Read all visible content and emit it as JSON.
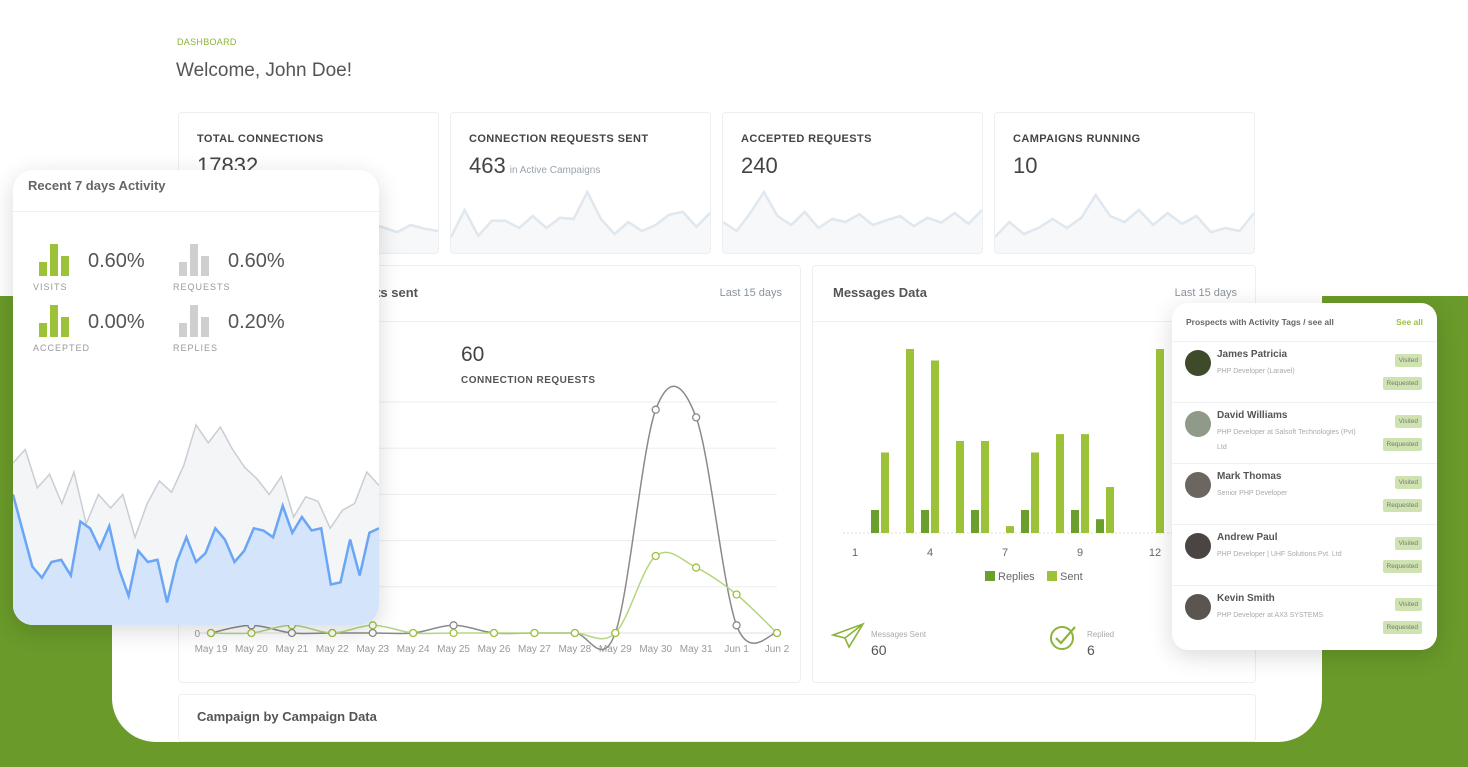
{
  "colors": {
    "brand_green": "#6a9a2a",
    "light_green": "#9cc23a",
    "dark_green": "#6a9f2e",
    "gray_line": "#8a8a8a",
    "blue": "#6aa6f5",
    "sparkline": "#dfe7ef"
  },
  "header": {
    "breadcrumb": "DASHBOARD",
    "welcome": "Welcome, John Doe!"
  },
  "kpis": [
    {
      "label": "TOTAL CONNECTIONS",
      "value": "17832",
      "sub": "",
      "spark": [
        30,
        40,
        35,
        45,
        38,
        42,
        30,
        35,
        25,
        40,
        33,
        45,
        38,
        30,
        42,
        36,
        28,
        40,
        34,
        30
      ]
    },
    {
      "label": "CONNECTION REQUESTS SENT",
      "value": "463",
      "sub": "in Active Campaigns",
      "spark": [
        20,
        65,
        22,
        47,
        47,
        35,
        55,
        35,
        52,
        50,
        95,
        50,
        25,
        45,
        30,
        40,
        57,
        62,
        37,
        60
      ]
    },
    {
      "label": "ACCEPTED REQUESTS",
      "value": "240",
      "sub": "",
      "spark": [
        45,
        30,
        60,
        95,
        55,
        40,
        62,
        35,
        50,
        45,
        58,
        40,
        48,
        55,
        38,
        52,
        44,
        60,
        42,
        65
      ]
    },
    {
      "label": "CAMPAIGNS RUNNING",
      "value": "10",
      "sub": "",
      "spark": [
        20,
        45,
        25,
        35,
        50,
        35,
        52,
        90,
        55,
        45,
        65,
        40,
        60,
        42,
        55,
        28,
        35,
        30,
        60
      ]
    }
  ],
  "connections_chart": {
    "title": "Requests sent",
    "period": "Last 15 days",
    "total": "60",
    "total_label": "CONNECTION REQUESTS"
  },
  "messages_chart": {
    "title": "Messages Data",
    "period": "Last 15 days",
    "sent_label": "Messages Sent",
    "sent_value": "60",
    "replied_label": "Replied",
    "replied_value": "6"
  },
  "prospects": {
    "title": "Prospects with Activity Tags / see all",
    "see_all": "See all",
    "tag_visited": "Visited",
    "tag_requested": "Requested",
    "items": [
      {
        "name": "James Patricia",
        "desc": "PHP Developer (Laravel)"
      },
      {
        "name": "David Williams",
        "desc": "PHP Developer at Salsoft Technologies (Pvt) Ltd"
      },
      {
        "name": "Mark Thomas",
        "desc": "Senior PHP Developer"
      },
      {
        "name": "Andrew Paul",
        "desc": "PHP Developer | UHF Solutions Pvt. Ltd"
      },
      {
        "name": "Kevin Smith",
        "desc": "PHP Developer at AX3 SYSTEMS"
      }
    ]
  },
  "activity": {
    "title": "Recent 7 days Activity",
    "stats": [
      {
        "label": "VISITS",
        "value": "0.60%",
        "color": "#9cc23a"
      },
      {
        "label": "REQUESTS",
        "value": "0.60%",
        "color": "#cfcfcf"
      },
      {
        "label": "ACCEPTED",
        "value": "0.00%",
        "color": "#9cc23a"
      },
      {
        "label": "REPLIES",
        "value": "0.20%",
        "color": "#cfcfcf"
      }
    ]
  },
  "campaign_section": {
    "title": "Campaign by Campaign Data"
  },
  "chart_data": [
    {
      "type": "line",
      "title": "Requests sent",
      "x": [
        "May 19",
        "May 20",
        "May 21",
        "May 22",
        "May 23",
        "May 24",
        "May 25",
        "May 26",
        "May 27",
        "May 28",
        "May 29",
        "May 30",
        "May 31",
        "Jun 1",
        "Jun 2"
      ],
      "series": [
        {
          "color": "#8a8a8a",
          "values": [
            0,
            1,
            0,
            0,
            0,
            0,
            1,
            0,
            0,
            0,
            0,
            29,
            28,
            1,
            0
          ]
        },
        {
          "color": "#9cc23a",
          "values": [
            0,
            0,
            1,
            0,
            1,
            0,
            0,
            0,
            0,
            0,
            0,
            10,
            8.5,
            5,
            0
          ]
        }
      ],
      "ylim": [
        0,
        30
      ],
      "y_tick_labels": [
        "0"
      ],
      "grid": true
    },
    {
      "type": "bar",
      "title": "Messages Data",
      "x_tick_labels": [
        "1",
        "4",
        "7",
        "9",
        "12"
      ],
      "series": [
        {
          "name": "Replies",
          "color": "#6a9f2e",
          "values": [
            0,
            1,
            0,
            1,
            0,
            1,
            0,
            1,
            0,
            1,
            0.6,
            0,
            0
          ]
        },
        {
          "name": "Sent",
          "color": "#9cc23a",
          "values": [
            0,
            3.5,
            8,
            7.5,
            4,
            4,
            0.3,
            3.5,
            4.3,
            4.3,
            2,
            0,
            8
          ]
        }
      ],
      "legend": "bottom"
    },
    {
      "type": "area",
      "title": "Recent 7 days Activity",
      "series": [
        {
          "color": "#c9ced4",
          "values": [
            72,
            78,
            61,
            67,
            54,
            68,
            45,
            58,
            52,
            58,
            39,
            54,
            64,
            59,
            71,
            89,
            81,
            88,
            78,
            70,
            65,
            58,
            66,
            48,
            57,
            55,
            43,
            51,
            54,
            68,
            62
          ]
        },
        {
          "color": "#6aa6f5",
          "values": [
            58,
            42,
            26,
            21,
            28,
            29,
            22,
            46,
            43,
            34,
            44,
            25,
            13,
            33,
            28,
            29,
            10,
            28,
            39,
            28,
            32,
            43,
            38,
            28,
            33,
            43,
            42,
            39,
            53,
            41,
            48,
            42,
            43,
            18,
            19,
            38,
            22,
            41,
            43
          ]
        }
      ],
      "ylim": [
        0,
        100
      ]
    }
  ]
}
